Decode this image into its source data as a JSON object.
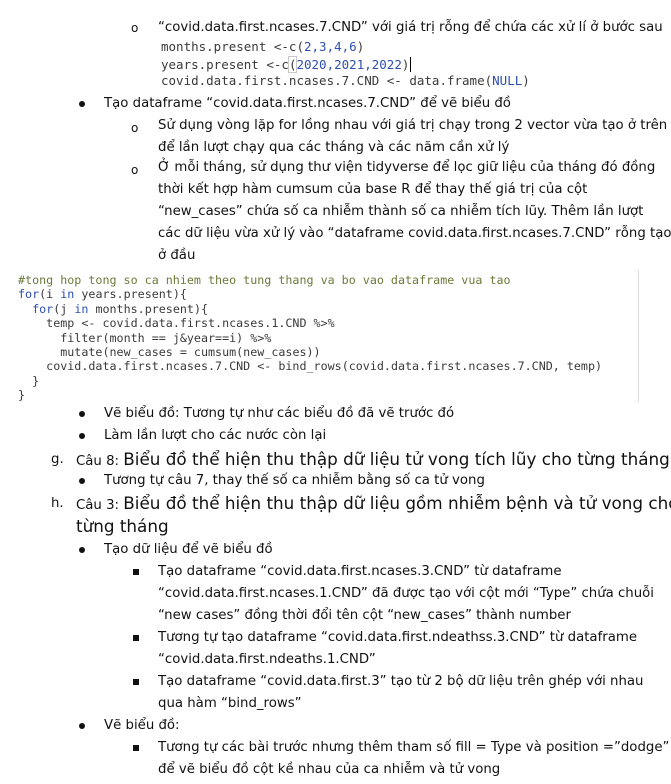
{
  "lines": {
    "l1": "“covid.data.first.ncases.7.CND” với giá trị rỗng để chứa các xử lí ở bước sau",
    "l5": "Tạo dataframe “covid.data.first.ncases.7.CND” để vẽ biểu đồ",
    "l6a": "Sử dụng vòng lặp for lồng nhau với giá trị chạy trong 2 vector vừa tạo ở trên",
    "l6b": "để lần lượt chạy qua các tháng và các năm cần xử lý",
    "l7a": "Ở mỗi tháng, sử dụng thư viện tidyverse để lọc giữ liệu của tháng đó đồng",
    "l7b": "thời kết hợp hàm cumsum của base R để thay thế giá trị của cột",
    "l7c": "“new_cases” chứa số ca nhiễm thành số ca nhiễm tích lũy. Thêm lần lượt",
    "l7d": "các dữ liệu vừa xử lý vào “dataframe covid.data.first.ncases.7.CND” rỗng tạo",
    "l7e": "ở đầu",
    "b1": "Vẽ biểu đồ: Tương tự như các biểu đồ đã vẽ trước đó",
    "b2": "Làm lần lượt cho các nước còn lại",
    "g_label": "g.",
    "g_small": "Câu 8: ",
    "g_big": "Biểu đồ thể hiện thu thập dữ liệu tử vong tích lũy cho từng tháng",
    "g_b1": "Tương tự câu 7, thay thế số ca nhiễm bằng số ca tử vong",
    "h_label": "h.",
    "h_small": "Câu 3: ",
    "h_big1": "Biểu đồ thể hiện thu thập dữ liệu gồm nhiễm bệnh và tử vong cho",
    "h_big2": "từng tháng",
    "h_b1": "Tạo dữ liệu để vẽ biểu đồ",
    "h_s1a": "Tạo dataframe “covid.data.first.ncases.3.CND” từ dataframe",
    "h_s1b": "“covid.data.first.ncases.1.CND” đã được tạo với cột mới “Type” chứa chuỗi",
    "h_s1c": "“new cases” đồng thời đổi tên cột “new_cases” thành number",
    "h_s2a": "Tương tự tạo dataframe “covid.data.first.ndeathss.3.CND” từ dataframe",
    "h_s2b": "“covid.data.first.ndeaths.1.CND”",
    "h_s3a": "Tạo dataframe “covid.data.first.3” tạo từ 2 bộ dữ liệu trên ghép với nhau",
    "h_s3b": "qua hàm “bind_rows”",
    "h_b2": "Vẽ biểu đồ:",
    "h_s4a": "Tương tự các bài trước nhưng thêm tham số fill = Type và position =”dodge”",
    "h_s4b": "để vẽ biểu đồ cột kề nhau của ca nhiễm và tử vong"
  },
  "inline_code": {
    "c1_var": "months.present",
    "c1_op": " <-c(",
    "c1_vals": "2,3,4,6",
    "c1_end": ")",
    "c2_var": "years.present",
    "c2_op": " <-c",
    "c2_paren": "(",
    "c2_vals": "2020,2021,2022",
    "c2_end": ")",
    "c3_var": "covid.data.first.ncases.7.CND",
    "c3_op": " <- data.frame(",
    "c3_null": "NULL",
    "c3_end": ")"
  },
  "code_block": {
    "comment": "#tong hop tong so ca nhiem theo tung thang va bo vao dataframe vua tao",
    "for1_kw": "for",
    "for1_rest_a": "(i ",
    "for1_in": "in",
    "for1_rest_b": " years.present){",
    "for2_kw": "for",
    "for2_rest_a": "(j ",
    "for2_in": "in",
    "for2_rest_b": " months.present){",
    "line4": "temp <- covid.data.first.ncases.1.CND %>%",
    "line5": "filter(month == j&year==i) %>%",
    "line6": "mutate(new_cases = cumsum(new_cases))",
    "line7": "covid.data.first.ncases.7.CND <- bind_rows(covid.data.first.ncases.7.CND, temp)",
    "close1": "}",
    "close2": "}"
  }
}
